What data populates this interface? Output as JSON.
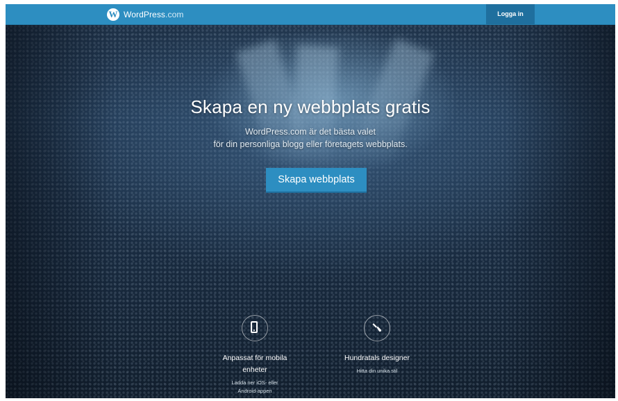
{
  "topbar": {
    "brand_name": "WordPress",
    "brand_tld": ".com",
    "login_label": "Logga in"
  },
  "hero": {
    "headline": "Skapa en ny webbplats gratis",
    "subline_1": "WordPress.com är det bästa valet",
    "subline_2": "för din personliga blogg eller företagets webbplats.",
    "cta_label": "Skapa webbplats"
  },
  "features": [
    {
      "icon": "mobile-phone-icon",
      "title_1": "Anpassat för mobila",
      "title_2": "enheter",
      "desc_1": "Ladda ner iOS- eller",
      "desc_2": "Android-appen"
    },
    {
      "icon": "paintbrush-icon",
      "title_1": "Hundratals designer",
      "desc_1": "Hitta din unika stil"
    }
  ],
  "colors": {
    "accent": "#2d8ec1",
    "accent_dark": "#1f6f9e",
    "background": "#1b2a3a"
  }
}
